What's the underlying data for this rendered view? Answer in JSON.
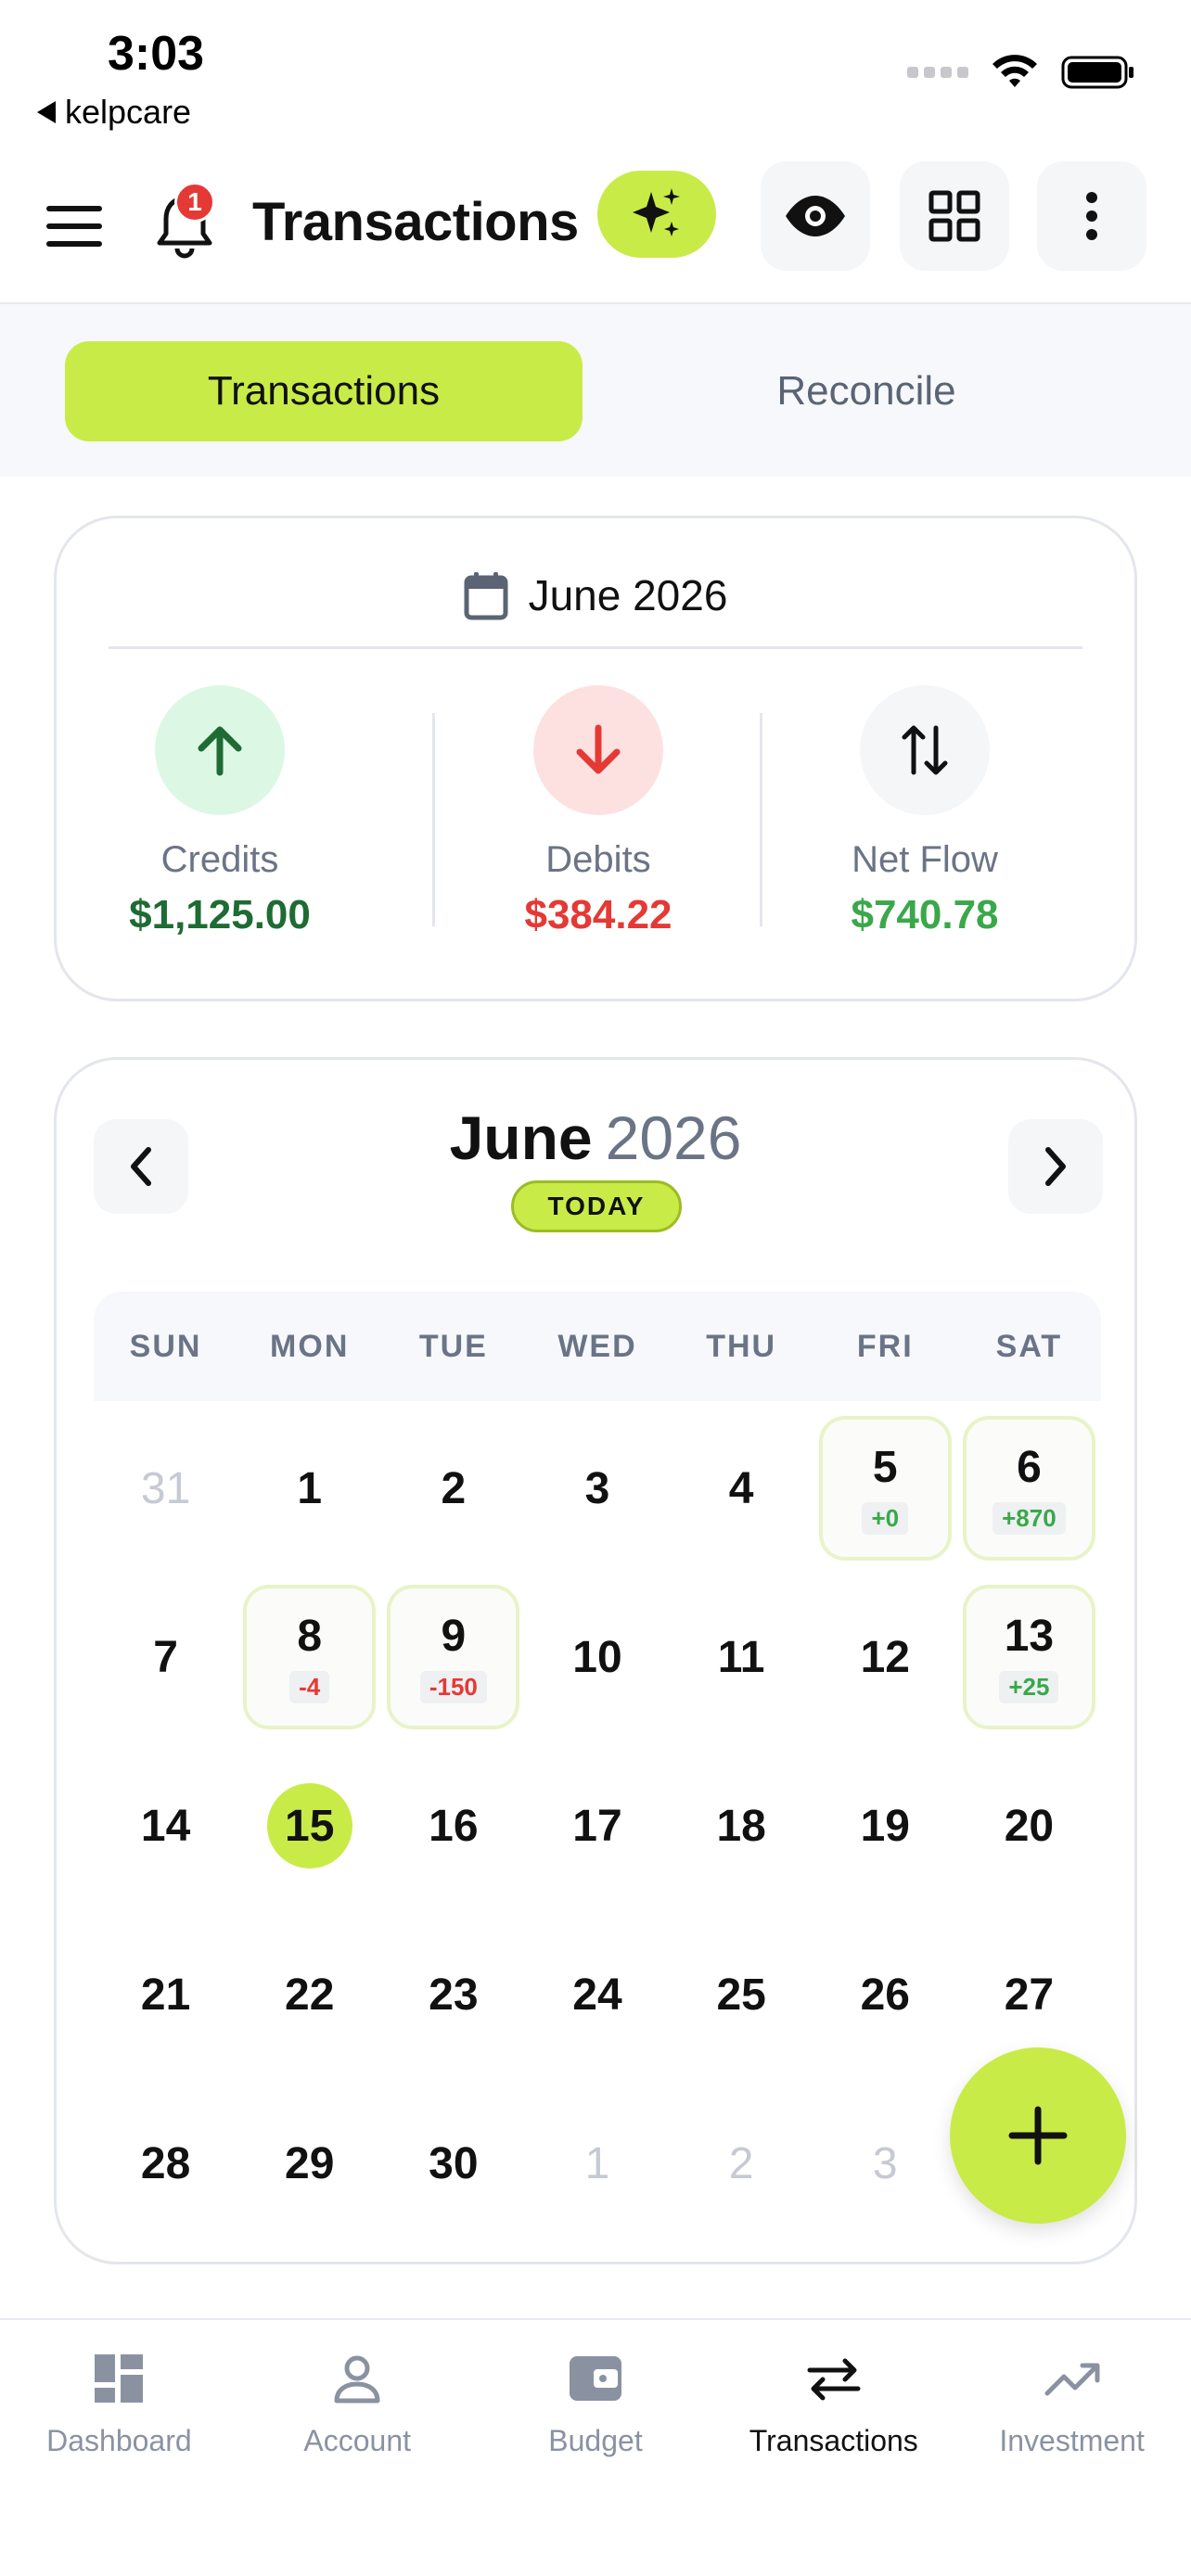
{
  "status_bar": {
    "time": "3:03",
    "back_app": "kelpcare"
  },
  "header": {
    "title": "Transactions",
    "notification_count": "1",
    "icons": {
      "menu": "hamburger-icon",
      "bell": "bell-icon",
      "ai": "sparkle-icon",
      "visibility": "eye-icon",
      "grid": "grid-icon",
      "more": "more-vertical-icon"
    }
  },
  "tabs": [
    {
      "label": "Transactions",
      "active": true
    },
    {
      "label": "Reconcile",
      "active": false
    }
  ],
  "summary": {
    "month": "June 2026",
    "credits": {
      "label": "Credits",
      "value": "$1,125.00",
      "color": "#1e6b34"
    },
    "debits": {
      "label": "Debits",
      "value": "$384.22",
      "color": "#e53935"
    },
    "net": {
      "label": "Net Flow",
      "value": "$740.78",
      "color": "#3aa84a"
    }
  },
  "calendar": {
    "month": "June",
    "year": "2026",
    "today_label": "TODAY",
    "weekdays": [
      "SUN",
      "MON",
      "TUE",
      "WED",
      "THU",
      "FRI",
      "SAT"
    ],
    "weeks": [
      [
        {
          "d": "31",
          "muted": true
        },
        {
          "d": "1"
        },
        {
          "d": "2"
        },
        {
          "d": "3"
        },
        {
          "d": "4"
        },
        {
          "d": "5",
          "delta": "+0",
          "sign": "pos"
        },
        {
          "d": "6",
          "delta": "+870",
          "sign": "pos"
        }
      ],
      [
        {
          "d": "7"
        },
        {
          "d": "8",
          "delta": "-4",
          "sign": "neg"
        },
        {
          "d": "9",
          "delta": "-150",
          "sign": "neg"
        },
        {
          "d": "10"
        },
        {
          "d": "11"
        },
        {
          "d": "12"
        },
        {
          "d": "13",
          "delta": "+25",
          "sign": "pos"
        }
      ],
      [
        {
          "d": "14"
        },
        {
          "d": "15",
          "today": true
        },
        {
          "d": "16"
        },
        {
          "d": "17"
        },
        {
          "d": "18"
        },
        {
          "d": "19"
        },
        {
          "d": "20"
        }
      ],
      [
        {
          "d": "21"
        },
        {
          "d": "22"
        },
        {
          "d": "23"
        },
        {
          "d": "24"
        },
        {
          "d": "25"
        },
        {
          "d": "26"
        },
        {
          "d": "27"
        }
      ],
      [
        {
          "d": "28"
        },
        {
          "d": "29"
        },
        {
          "d": "30"
        },
        {
          "d": "1",
          "muted": true
        },
        {
          "d": "2",
          "muted": true
        },
        {
          "d": "3",
          "muted": true
        },
        {
          "d": "",
          "muted": true
        }
      ]
    ]
  },
  "bottom_nav": [
    {
      "label": "Dashboard",
      "icon": "dashboard-icon",
      "active": false
    },
    {
      "label": "Account",
      "icon": "person-icon",
      "active": false
    },
    {
      "label": "Budget",
      "icon": "wallet-icon",
      "active": false
    },
    {
      "label": "Transactions",
      "icon": "swap-arrows-icon",
      "active": true
    },
    {
      "label": "Investment",
      "icon": "trending-up-icon",
      "active": false
    }
  ],
  "colors": {
    "accent": "#c9eb48",
    "muted_text": "#6b7486",
    "border": "#e3e6ec"
  }
}
